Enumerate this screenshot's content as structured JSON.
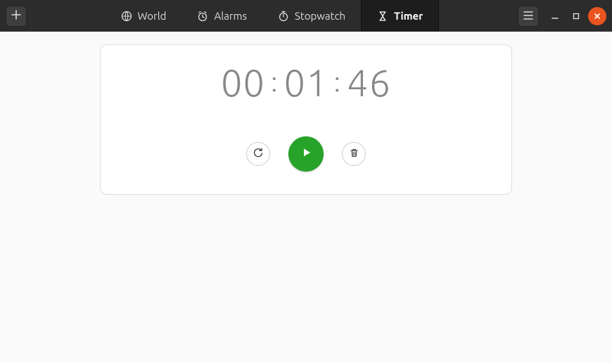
{
  "header": {
    "tabs": [
      {
        "label": "World"
      },
      {
        "label": "Alarms"
      },
      {
        "label": "Stopwatch"
      },
      {
        "label": "Timer"
      }
    ],
    "activeTab": "Timer"
  },
  "timer": {
    "hours": "00",
    "minutes": "01",
    "seconds": "46",
    "sep": ":"
  }
}
